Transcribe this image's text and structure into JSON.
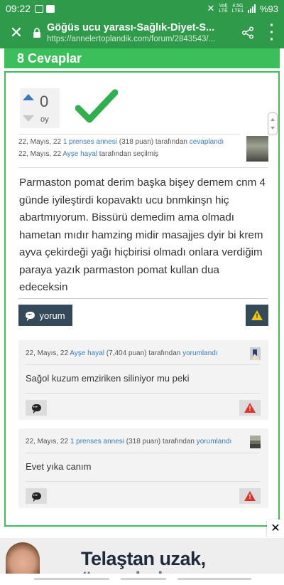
{
  "status_bar": {
    "time": "09:22",
    "network_top": "Vol)",
    "network_bottom": "LTE",
    "speed_top": "4.5G",
    "speed_bottom": "LTE1",
    "battery": "%93"
  },
  "browser": {
    "page_title": "Göğüs ucu yarası-Sağlık-Diyet-S...",
    "url": "https://annelertoplandik.com/forum/2843543/..."
  },
  "answers_header": "8 Cevaplar",
  "answer": {
    "votes": "0",
    "votes_label": "oy",
    "meta1": {
      "date": "22, Mayıs, 22",
      "user": "1 prenses annesi",
      "points": "(318 puan)",
      "by": "tarafından",
      "action": "cevaplandı"
    },
    "meta2": {
      "date": "22, Mayıs, 22",
      "user": "Ayşe hayal",
      "suffix": "tarafından seçilmiş"
    },
    "text": "Parmaston pomat derim başka bişey demem cnm 4 günde iyileştirdi kopavaktı ucu bnmkinşn hiç abartmıyorum. Bissürü demedim ama olmadı hametan mıdır hamzing midir masajjes dyir bi krem ayva çekirdeği yağı hiçbirisi olmadı onlara verdiğim paraya yazık parmaston pomat kullan dua edeceksin",
    "comment_button": "yorum"
  },
  "comments": [
    {
      "date": "22, Mayıs, 22",
      "user": "Ayşe hayal",
      "points": "(7,404 puan)",
      "by": "tarafından",
      "action": "yorumlandı",
      "text": "Sağol kuzum emziriken siliniyor mu peki"
    },
    {
      "date": "22, Mayıs, 22",
      "user": "1 prenses annesi",
      "points": "(318 puan)",
      "by": "tarafından",
      "action": "yorumlandı",
      "text": "Evet yıka canım"
    }
  ],
  "ad": {
    "line1": "Telaştan uzak,",
    "line2": "üç ay kolay"
  },
  "colors": {
    "brand_green": "#2e9a4a",
    "header_green": "#3bbf5a",
    "link_blue": "#3a7bbf",
    "button_dark": "#34495a",
    "warn_yellow": "#f1c40f",
    "warn_red": "#d9352d"
  }
}
